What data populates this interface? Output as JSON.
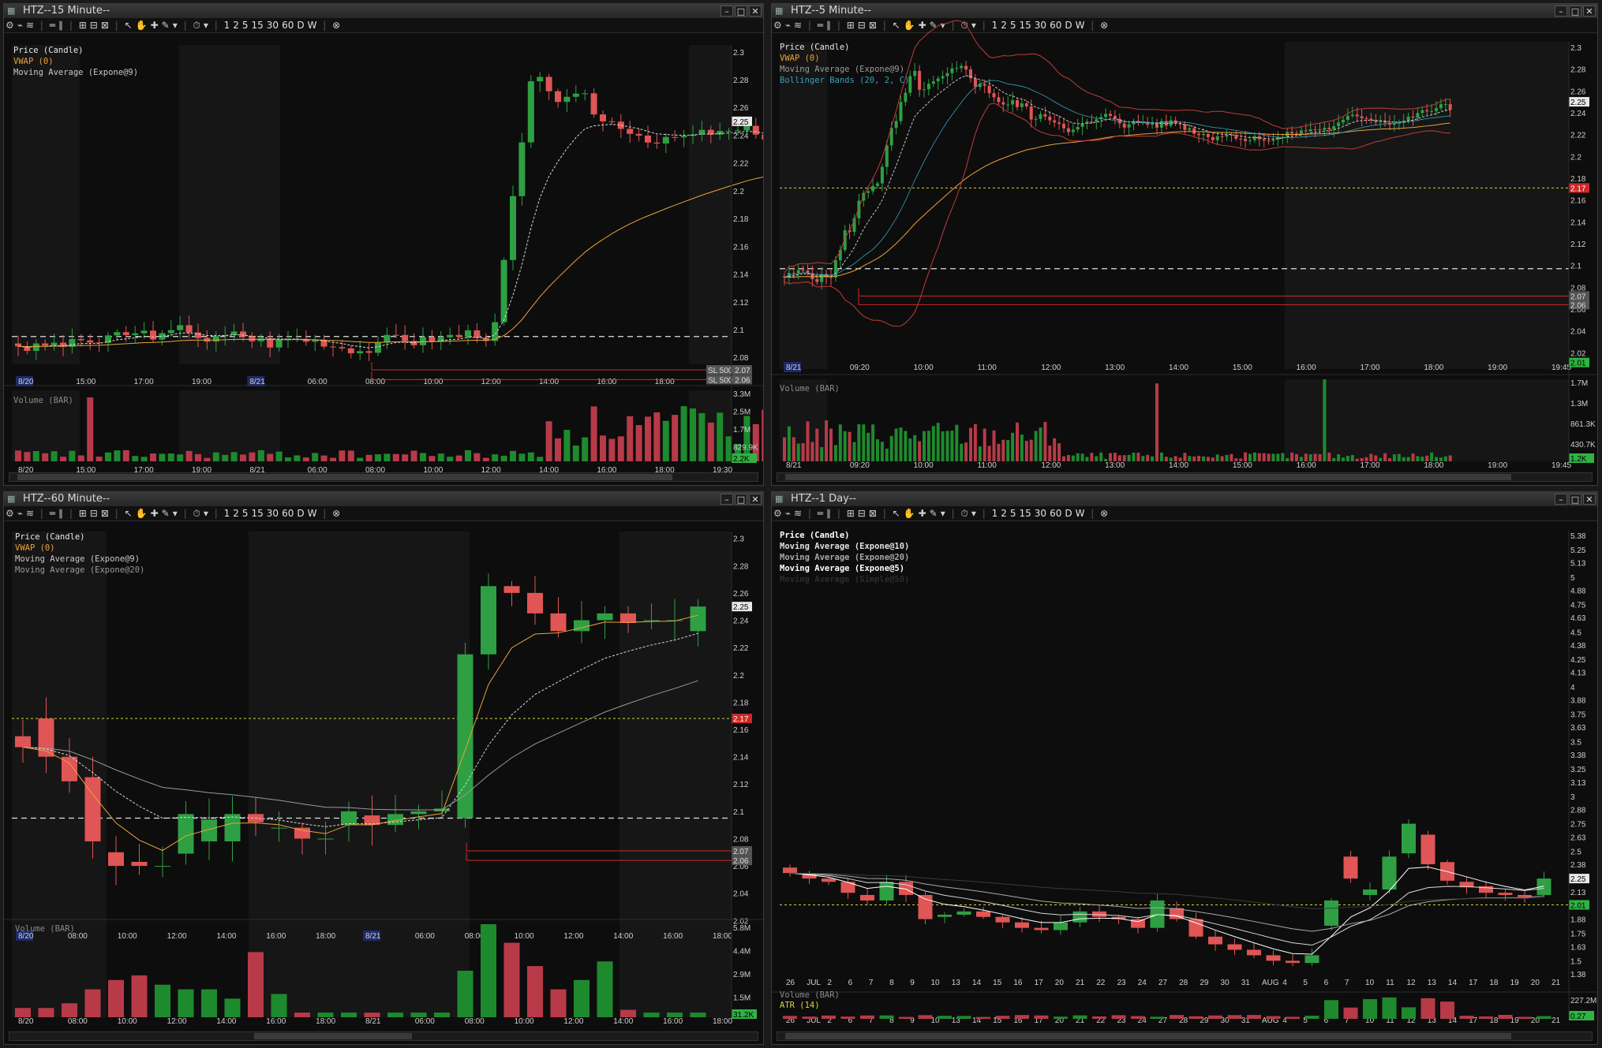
{
  "colors": {
    "up": "#2ea043",
    "down": "#e05555",
    "vwap": "#e8a23c",
    "ema": "#cfcfcf",
    "ma20": "#9a9a9a",
    "bb": "#c23b3b",
    "bb_mid": "#3aa0b8",
    "level": "#ffffff",
    "stop": "#d02828",
    "hl": "#d6d23a"
  },
  "windows": [
    {
      "title": "HTZ--15 Minute--",
      "timeframes": [
        "1",
        "2",
        "5",
        "15",
        "30",
        "60",
        "D",
        "W"
      ],
      "legend": [
        {
          "text": "Price (Candle)",
          "color": "#e8e8e8"
        },
        {
          "text": "VWAP (0)",
          "color": "#e8a23c"
        },
        {
          "text": "Moving Average (Expone@9)",
          "color": "#c8c8c8"
        }
      ],
      "price_ticks": [
        "2.3",
        "2.28",
        "2.26",
        "2.24",
        "2.22",
        "2.2",
        "2.18",
        "2.16",
        "2.14",
        "2.12",
        "2.1",
        "2.08"
      ],
      "time_labels": [
        "8/20",
        "15:00",
        "17:00",
        "19:00",
        "8/21",
        "06:00",
        "08:00",
        "10:00",
        "12:00",
        "14:00",
        "16:00",
        "18:00",
        "19:30"
      ],
      "tags": [
        {
          "text": "2.25",
          "type": "price"
        },
        {
          "text": "SL 500  2.07",
          "type": "order"
        },
        {
          "text": "SL 500  2.06",
          "type": "order"
        }
      ],
      "volume_label": "Volume (BAR)",
      "volume_ticks": [
        "3.3M",
        "2.5M",
        "1.7M",
        "829.9K"
      ],
      "volume_tag": "2.2K"
    },
    {
      "title": "HTZ--5 Minute--",
      "timeframes": [
        "1",
        "2",
        "5",
        "15",
        "30",
        "60",
        "D",
        "W"
      ],
      "legend": [
        {
          "text": "Price (Candle)",
          "color": "#e8e8e8"
        },
        {
          "text": "VWAP (0)",
          "color": "#e8a23c"
        },
        {
          "text": "Moving Average (Expone@9)",
          "color": "#9a9a9a"
        },
        {
          "text": "Bollinger Bands (20, 2, C)",
          "color": "#3aa0b8"
        }
      ],
      "price_ticks": [
        "2.3",
        "2.28",
        "2.26",
        "2.24",
        "2.22",
        "2.2",
        "2.18",
        "2.16",
        "2.14",
        "2.12",
        "2.1",
        "2.08",
        "2.06",
        "2.04",
        "2.02"
      ],
      "time_labels": [
        "8/21",
        "09:20",
        "10:00",
        "11:00",
        "12:00",
        "13:00",
        "14:00",
        "15:00",
        "16:00",
        "17:00",
        "18:00",
        "19:00",
        "19:45"
      ],
      "tags": [
        {
          "text": "2.25",
          "type": "price"
        },
        {
          "text": "2.17",
          "type": "red"
        },
        {
          "text": "2.07",
          "type": "order"
        },
        {
          "text": "2.06",
          "type": "order"
        },
        {
          "text": "2.01",
          "type": "green"
        }
      ],
      "volume_label": "Volume (BAR)",
      "volume_ticks": [
        "1.7M",
        "1.3M",
        "861.3K",
        "430.7K"
      ],
      "volume_tag": "1.2K"
    },
    {
      "title": "HTZ--60 Minute--",
      "timeframes": [
        "1",
        "2",
        "5",
        "15",
        "30",
        "60",
        "D",
        "W"
      ],
      "legend": [
        {
          "text": "Price (Candle)",
          "color": "#e8e8e8"
        },
        {
          "text": "VWAP (0)",
          "color": "#e8a23c"
        },
        {
          "text": "Moving Average (Expone@9)",
          "color": "#c8c8c8"
        },
        {
          "text": "Moving Average (Expone@20)",
          "color": "#9a9a9a"
        }
      ],
      "price_ticks": [
        "2.3",
        "2.28",
        "2.26",
        "2.24",
        "2.22",
        "2.2",
        "2.18",
        "2.16",
        "2.14",
        "2.12",
        "2.1",
        "2.08",
        "2.06",
        "2.04",
        "2.02"
      ],
      "time_labels": [
        "8/20",
        "08:00",
        "10:00",
        "12:00",
        "14:00",
        "16:00",
        "18:00",
        "8/21",
        "06:00",
        "08:00",
        "10:00",
        "12:00",
        "14:00",
        "16:00",
        "18:00"
      ],
      "tags": [
        {
          "text": "2.25",
          "type": "price"
        },
        {
          "text": "2.17",
          "type": "red"
        },
        {
          "text": "2.07",
          "type": "order"
        },
        {
          "text": "2.06",
          "type": "order"
        }
      ],
      "volume_label": "Volume (BAR)",
      "volume_ticks": [
        "5.8M",
        "4.4M",
        "2.9M",
        "1.5M"
      ],
      "volume_tag": "31.2K"
    },
    {
      "title": "HTZ--1 Day--",
      "timeframes": [
        "1",
        "2",
        "5",
        "15",
        "30",
        "60",
        "D",
        "W"
      ],
      "legend": [
        {
          "text": "Price (Candle)",
          "color": "#ffffff"
        },
        {
          "text": "Moving Average (Expone@10)",
          "color": "#e0e0e0"
        },
        {
          "text": "Moving Average (Expone@20)",
          "color": "#a8a8a8"
        },
        {
          "text": "Moving Average (Expone@5)",
          "color": "#ffffff"
        },
        {
          "text": "Moving Average (Simple@50)",
          "color": "#2c2c2c"
        }
      ],
      "price_ticks": [
        "5.38",
        "5.25",
        "5.13",
        "5",
        "4.88",
        "4.75",
        "4.63",
        "4.5",
        "4.38",
        "4.25",
        "4.13",
        "4",
        "3.88",
        "3.75",
        "3.63",
        "3.5",
        "3.38",
        "3.25",
        "3.13",
        "3",
        "2.88",
        "2.75",
        "2.63",
        "2.5",
        "2.38",
        "2.25",
        "2.13",
        "2",
        "1.88",
        "1.75",
        "1.63",
        "1.5",
        "1.38"
      ],
      "time_labels": [
        "26",
        "JUL",
        "2",
        "6",
        "7",
        "8",
        "9",
        "10",
        "13",
        "14",
        "15",
        "16",
        "17",
        "20",
        "21",
        "22",
        "23",
        "24",
        "27",
        "28",
        "29",
        "30",
        "31",
        "AUG",
        "4",
        "5",
        "6",
        "7",
        "10",
        "11",
        "12",
        "13",
        "14",
        "17",
        "18",
        "19",
        "20",
        "21"
      ],
      "tags": [
        {
          "text": "2.25",
          "type": "price"
        },
        {
          "text": "2.01",
          "type": "green"
        }
      ],
      "volume_label": "Volume (BAR)",
      "atr_label": "ATR (14)",
      "volume_ticks": [
        "227.2M"
      ],
      "volume_tag": "0.27"
    }
  ]
}
